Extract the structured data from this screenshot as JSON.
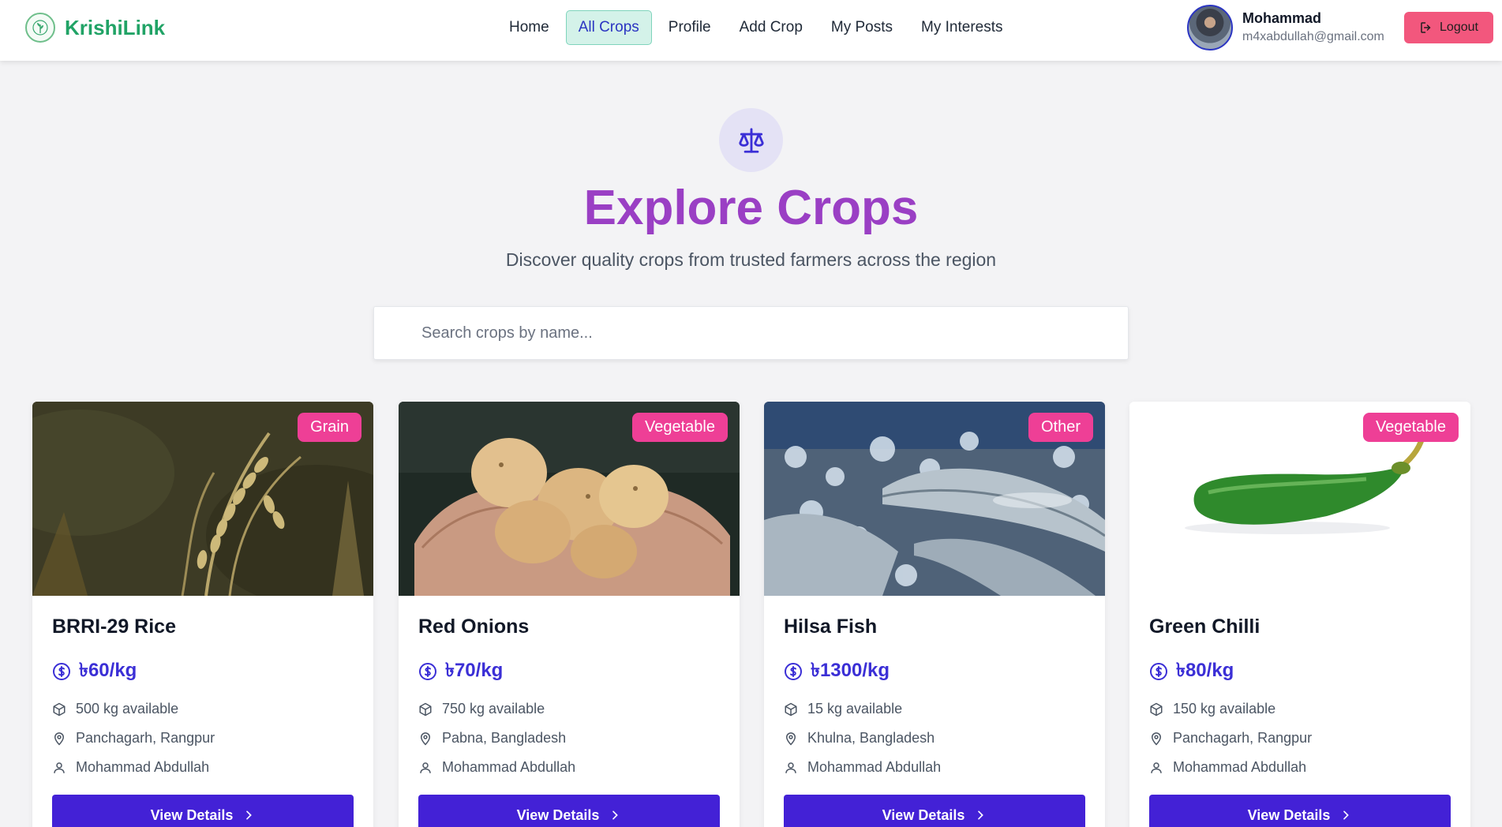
{
  "brand": {
    "name": "KrishiLink",
    "logo_icon": "leaf-globe-icon",
    "color": "#21a366"
  },
  "nav": {
    "links": [
      {
        "label": "Home",
        "active": false
      },
      {
        "label": "All Crops",
        "active": true
      },
      {
        "label": "Profile",
        "active": false
      },
      {
        "label": "Add Crop",
        "active": false
      },
      {
        "label": "My Posts",
        "active": false
      },
      {
        "label": "My Interests",
        "active": false
      }
    ]
  },
  "user": {
    "name": "Mohammad",
    "email": "m4xabdullah@gmail.com",
    "logout_label": "Logout"
  },
  "hero": {
    "icon": "scale-icon",
    "title": "Explore Crops",
    "subtitle": "Discover quality crops from trusted farmers across the region"
  },
  "search": {
    "placeholder": "Search crops by name...",
    "value": ""
  },
  "crops": [
    {
      "name": "BRRI-29 Rice",
      "category": "Grain",
      "price": "৳60/kg",
      "quantity": "500 kg available",
      "location": "Panchagarh, Rangpur",
      "farmer": "Mohammad Abdullah",
      "button_label": "View Details"
    },
    {
      "name": "Red Onions",
      "category": "Vegetable",
      "price": "৳70/kg",
      "quantity": "750 kg available",
      "location": "Pabna, Bangladesh",
      "farmer": "Mohammad Abdullah",
      "button_label": "View Details"
    },
    {
      "name": "Hilsa Fish",
      "category": "Other",
      "price": "৳1300/kg",
      "quantity": "15 kg available",
      "location": "Khulna, Bangladesh",
      "farmer": "Mohammad Abdullah",
      "button_label": "View Details"
    },
    {
      "name": "Green Chilli",
      "category": "Vegetable",
      "price": "৳80/kg",
      "quantity": "150 kg available",
      "location": "Panchagarh, Rangpur",
      "farmer": "Mohammad Abdullah",
      "button_label": "View Details"
    }
  ],
  "colors": {
    "accent": "#4321d6",
    "badge": "#ee3f96",
    "title": "#9a3fc4",
    "logout": "#f2577d",
    "price": "#3b2fd6"
  }
}
